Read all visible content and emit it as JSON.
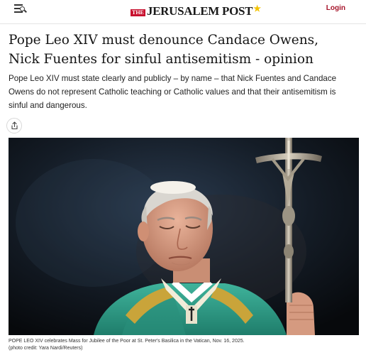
{
  "header": {
    "logo_the": "THE",
    "logo_text": "JERUSALEM POST",
    "logo_star": "★",
    "login_label": "Login",
    "menu_icon": "menu-search-icon"
  },
  "article": {
    "headline": "Pope Leo XIV must denounce Candace Owens, Nick Fuentes for sinful antisemitism - opinion",
    "dek": "Pope Leo XIV must state clearly and publicly – by name – that Nick Fuentes and Candace Owens do not represent Catholic teaching or Catholic values and that their antisemitism is sinful and dangerous.",
    "share_icon": "share-icon",
    "photo": {
      "caption": "POPE LEO XIV celebrates Mass for Jubilee of the Poor at St. Peter's Basilica in the Vatican, Nov. 16, 2025.",
      "credit": "(photo credit: Yara Nardi/Reuters)"
    }
  },
  "colors": {
    "brand_red": "#c8102e",
    "login_red": "#a6142a",
    "vestment_green": "#2f9a86",
    "gold": "#c9a43a"
  }
}
